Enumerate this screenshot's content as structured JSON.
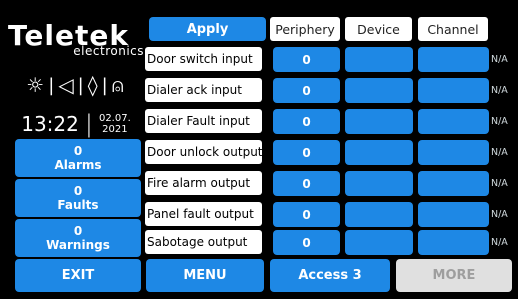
{
  "brand": {
    "name": "Teletek",
    "subtitle": "electronics"
  },
  "status_icons": [
    {
      "name": "sun-icon",
      "glyph": "☼"
    },
    {
      "name": "speaker-icon",
      "glyph": "◁"
    },
    {
      "name": "flame-icon",
      "glyph": "◊"
    },
    {
      "name": "extinguisher-icon",
      "glyph": "⍝"
    }
  ],
  "clock": {
    "time": "13:22",
    "date_line1": "02.07.",
    "date_line2": "2021"
  },
  "counters": [
    {
      "value": "0",
      "label": "Alarms"
    },
    {
      "value": "0",
      "label": "Faults"
    },
    {
      "value": "0",
      "label": "Warnings"
    }
  ],
  "apply_label": "Apply",
  "headers": {
    "periphery": "Periphery",
    "device": "Device",
    "channel": "Channel"
  },
  "rows": [
    {
      "name": "Door switch input",
      "periphery": "0",
      "device": "",
      "channel": "",
      "na": "N/A"
    },
    {
      "name": "Dialer ack input",
      "periphery": "0",
      "device": "",
      "channel": "",
      "na": "N/A"
    },
    {
      "name": "Dialer Fault input",
      "periphery": "0",
      "device": "",
      "channel": "",
      "na": "N/A"
    },
    {
      "name": "Door unlock output",
      "periphery": "0",
      "device": "",
      "channel": "",
      "na": "N/A"
    },
    {
      "name": "Fire alarm output",
      "periphery": "0",
      "device": "",
      "channel": "",
      "na": "N/A"
    },
    {
      "name": "Panel fault output",
      "periphery": "0",
      "device": "",
      "channel": "",
      "na": "N/A"
    },
    {
      "name": "Sabotage output",
      "periphery": "0",
      "device": "",
      "channel": "",
      "na": "N/A"
    }
  ],
  "bottom": {
    "exit": "EXIT",
    "menu": "MENU",
    "access": "Access 3",
    "more": "MORE"
  },
  "colors": {
    "accent": "#1e88e5",
    "background": "#000000",
    "disabled": "#e0e0e0"
  }
}
